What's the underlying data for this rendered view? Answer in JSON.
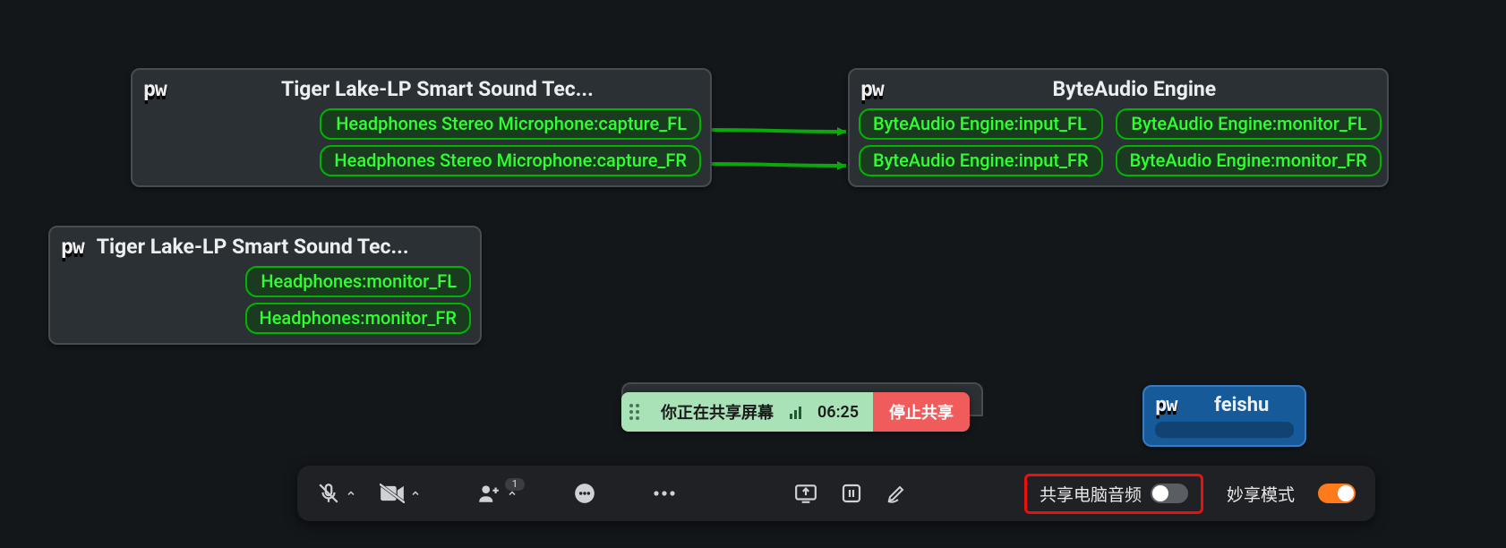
{
  "nodes": {
    "source1": {
      "title": "Tiger Lake-LP Smart Sound Tec...",
      "ports_out": [
        "Headphones Stereo Microphone:capture_FL",
        "Headphones Stereo Microphone:capture_FR"
      ]
    },
    "byteaudio": {
      "title": "ByteAudio Engine",
      "ports_in": [
        "ByteAudio Engine:input_FL",
        "ByteAudio Engine:input_FR"
      ],
      "ports_out": [
        "ByteAudio Engine:monitor_FL",
        "ByteAudio Engine:monitor_FR"
      ]
    },
    "source2": {
      "title": "Tiger Lake-LP Smart Sound Tec...",
      "ports_out": [
        "Headphones:monitor_FL",
        "Headphones:monitor_FR"
      ]
    },
    "feishu_node": {
      "title": "feishu"
    }
  },
  "share_bar": {
    "status_text": "你正在共享屏幕",
    "time": "06:25",
    "stop_label": "停止共享"
  },
  "toolbar": {
    "participants_badge": "1",
    "audio_share_label": "共享电脑音频",
    "audio_share_on": false,
    "mode_label": "妙享模式",
    "mode_on": true
  }
}
